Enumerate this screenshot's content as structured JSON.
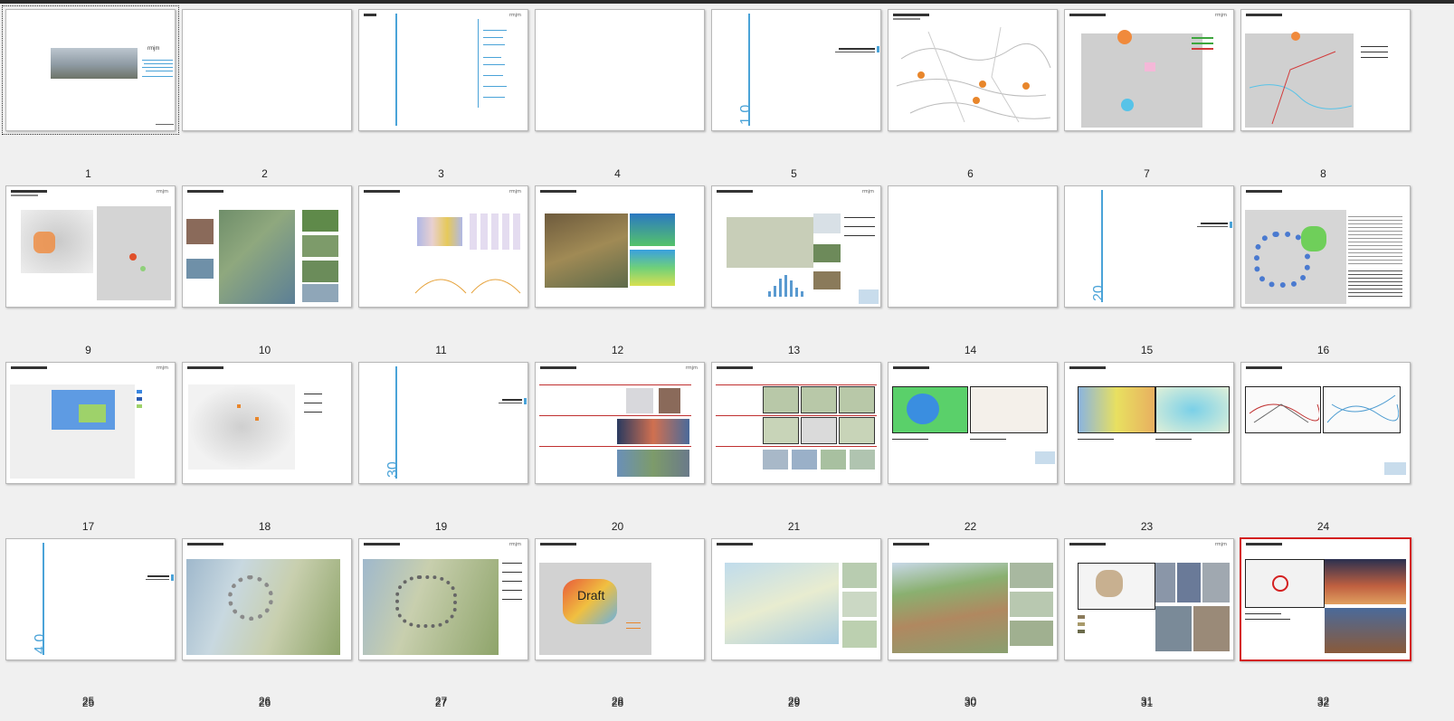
{
  "slides": [
    {
      "number": "1"
    },
    {
      "number": "2"
    },
    {
      "number": "3"
    },
    {
      "number": "4"
    },
    {
      "number": "5"
    },
    {
      "number": "6"
    },
    {
      "number": "7"
    },
    {
      "number": "8"
    },
    {
      "number": "9"
    },
    {
      "number": "10"
    },
    {
      "number": "11"
    },
    {
      "number": "12"
    },
    {
      "number": "13"
    },
    {
      "number": "14"
    },
    {
      "number": "15"
    },
    {
      "number": "16"
    },
    {
      "number": "17"
    },
    {
      "number": "18"
    },
    {
      "number": "19"
    },
    {
      "number": "20"
    },
    {
      "number": "21"
    },
    {
      "number": "22"
    },
    {
      "number": "23"
    },
    {
      "number": "24"
    },
    {
      "number": "25"
    },
    {
      "number": "26"
    },
    {
      "number": "27"
    },
    {
      "number": "28"
    },
    {
      "number": "29"
    },
    {
      "number": "30"
    },
    {
      "number": "31"
    },
    {
      "number": "32"
    }
  ],
  "slide_text": {
    "logo": "rmjm",
    "section_10": "1.0",
    "section_20": "20",
    "section_30": "30",
    "section_40": "4.0",
    "draft": "Draft"
  },
  "selection": {
    "focused": "1",
    "selected": "24"
  },
  "colors": {
    "accent": "#4aa3d8",
    "selected_border": "#d42020",
    "background": "#f0f0f0"
  }
}
